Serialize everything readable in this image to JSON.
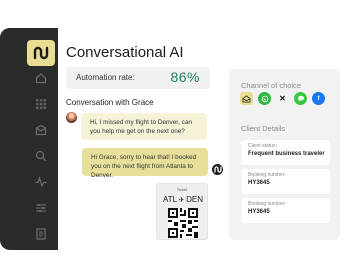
{
  "app": {
    "title": "Conversational AI"
  },
  "sidebar": {
    "logo_icon": "brand-logo-icon",
    "items": [
      {
        "icon": "home-icon"
      },
      {
        "icon": "grid-icon"
      },
      {
        "icon": "inbox-icon"
      },
      {
        "icon": "search-icon"
      },
      {
        "icon": "activity-icon"
      },
      {
        "icon": "sliders-icon"
      },
      {
        "icon": "document-icon"
      }
    ]
  },
  "automation": {
    "label": "Automation rate:",
    "value": "86%",
    "value_color": "#1f7d68"
  },
  "conversation": {
    "heading": "Conversation with Grace",
    "messages": [
      {
        "from": "customer",
        "text": "Hi, I missed my flight to Denver, can you help me get on the next one?"
      },
      {
        "from": "agent",
        "text": "Hi Grace, sorry to hear that! I booked you on the next flight from Atlanta to Denver."
      }
    ],
    "ticket": {
      "label": "Ticket",
      "from": "ATL",
      "to": "DEN",
      "plane_icon": "plane-icon",
      "qr_icon": "qr-code-icon"
    }
  },
  "right_panel": {
    "channel_heading": "Channel of choice",
    "channels": [
      {
        "icon": "email-icon",
        "color": "#e8dd93"
      },
      {
        "icon": "whatsapp-icon",
        "color": "#2db742"
      },
      {
        "icon": "x-icon",
        "color": "#111111"
      },
      {
        "icon": "imessage-icon",
        "color": "#37c83f"
      },
      {
        "icon": "facebook-icon",
        "color": "#1877f2"
      }
    ],
    "client_heading": "Client Details",
    "details": [
      {
        "label": "Client status:",
        "value": "Frequent business traveler"
      },
      {
        "label": "Booking number:",
        "value": "HY3645"
      },
      {
        "label": "Booking number:",
        "value": "HY3645"
      }
    ]
  },
  "colors": {
    "rail": "#2b2b2b",
    "accent": "#e8dd93",
    "agent_bubble": "#e8df9a",
    "customer_bubble": "#f5f2d8"
  }
}
